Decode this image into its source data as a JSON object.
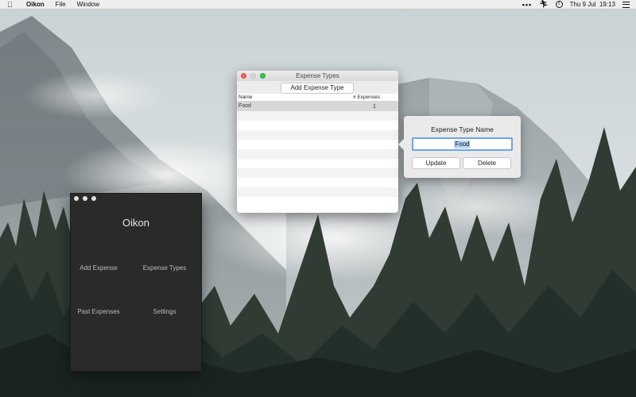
{
  "menubar": {
    "apple_icon": "apple-icon",
    "app_name": "Oikon",
    "menus": [
      "File",
      "Window"
    ],
    "status": {
      "more_icon": "•••",
      "activity_icon": "runner-icon",
      "alert_icon": "!",
      "date_time": "Thu 9 Jul  19:13",
      "list_icon": "list-icon"
    }
  },
  "oikon_window": {
    "title": "Oikon",
    "buttons": {
      "add_expense": "Add Expense",
      "expense_types": "Expense Types",
      "past_expenses": "Past Expenses",
      "settings": "Settings"
    }
  },
  "types_window": {
    "title": "Expense Types",
    "add_button": "Add Expense Type",
    "columns": {
      "name": "Name",
      "count": "# Expenses"
    },
    "rows": [
      {
        "name": "Food",
        "count": "1"
      }
    ]
  },
  "popover": {
    "title": "Expense Type Name",
    "input_value": "Food",
    "update_label": "Update",
    "delete_label": "Delete"
  },
  "colors": {
    "selection": "#b5d5fd",
    "focus_ring": "#6aa6ea",
    "close": "#fc605c",
    "zoom": "#34c84a",
    "dark_window": "#2a2a2a"
  }
}
